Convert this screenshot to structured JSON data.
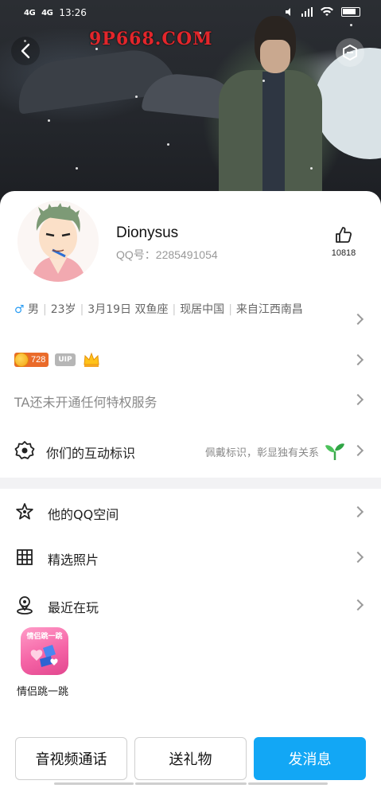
{
  "status_bar": {
    "signal1": "4G",
    "signal2": "4G",
    "time": "13:26"
  },
  "header": {
    "watermark": "9P668.COM"
  },
  "profile": {
    "name": "Dionysus",
    "qq_label": "QQ号：",
    "qq_number": "2285491054",
    "likes": "10818",
    "gender_symbol": "♂",
    "gender": "男",
    "age": "23岁",
    "birthday": "3月19日",
    "zodiac": "双鱼座",
    "current_city": "现居中国",
    "hometown": "来自江西南昌"
  },
  "badges": {
    "coin_level": "728",
    "uip_label": "UIP"
  },
  "privilege_text": "TA还未开通任何特权服务",
  "interaction": {
    "label": "你们的互动标识",
    "hint": "佩戴标识，彰显独有关系"
  },
  "menu": {
    "qzone": "他的QQ空间",
    "photos": "精选照片",
    "recent": "最近在玩"
  },
  "recent_game": {
    "name": "情侣跳一跳",
    "banner": "情侣跳一跳"
  },
  "actions": {
    "call": "音视频通话",
    "gift": "送礼物",
    "message": "发消息"
  },
  "colors": {
    "accent": "#12a7f5",
    "coin_badge": "#ea6b2a",
    "male": "#2a9df4"
  }
}
